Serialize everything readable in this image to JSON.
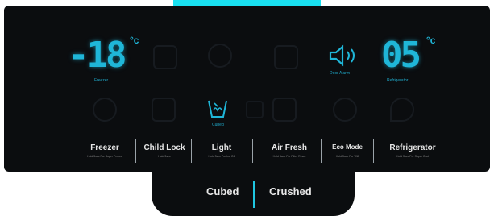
{
  "freezer": {
    "temp": "-18",
    "unit": "°c",
    "label": "Freezer"
  },
  "refrigerator": {
    "temp": "05",
    "unit": "°c",
    "label": "Refrigerator"
  },
  "door_alarm": {
    "label": "Door Alarm"
  },
  "cubed_icon": {
    "label": "Cubed"
  },
  "buttons": [
    {
      "label": "Freezer",
      "hint": "Hold 3sec For Super Freeze"
    },
    {
      "label": "Child Lock",
      "hint": "Hold 3sec"
    },
    {
      "label": "Light",
      "hint": "Hold 3sec For Ice Off"
    },
    {
      "label": "Air Fresh",
      "hint": "Hold 3sec For Filter Reset"
    },
    {
      "label": "Eco Mode",
      "hint": "Hold 3sec For Wifi"
    },
    {
      "label": "Refrigerator",
      "hint": "Hold 3sec For Super Cool"
    }
  ],
  "dispenser": {
    "cubed": "Cubed",
    "crushed": "Crushed"
  },
  "colors": {
    "accent": "#1fb6d8",
    "panel": "#0b0d0f",
    "top_bar": "#19e0f0"
  }
}
